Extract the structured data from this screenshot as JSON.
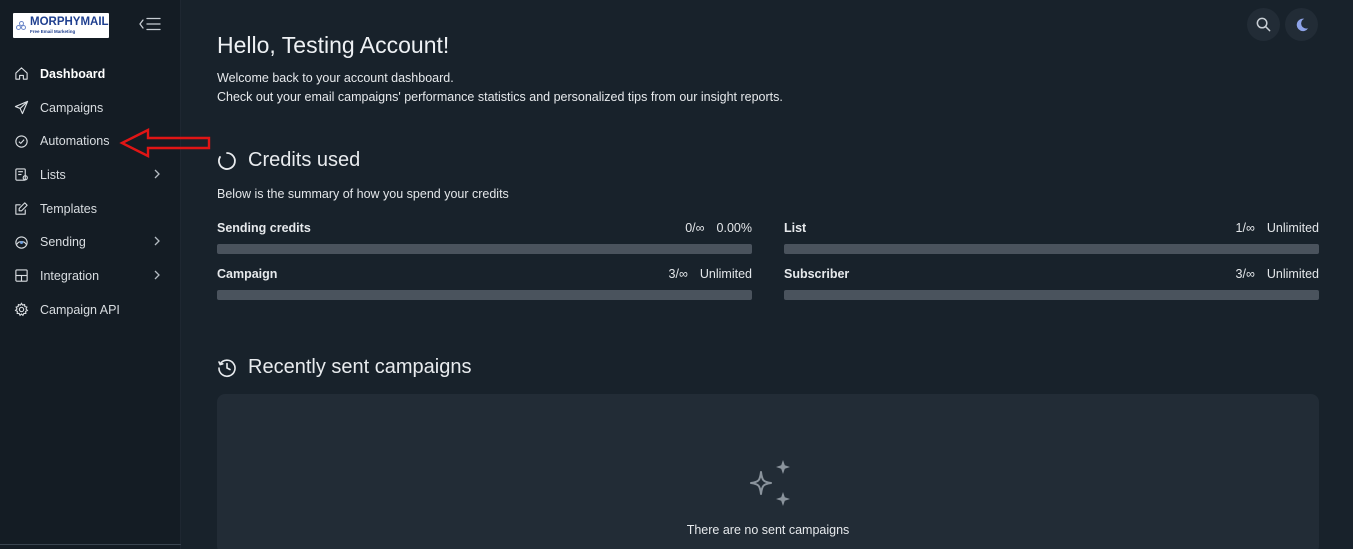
{
  "brand": {
    "logo_title": "MORPHYMAIL",
    "logo_subtitle": "Free Email Marketing"
  },
  "sidebar": {
    "items": [
      {
        "label": "Dashboard",
        "icon": "home-icon",
        "active": true,
        "has_submenu": false
      },
      {
        "label": "Campaigns",
        "icon": "paper-plane-icon",
        "active": false,
        "has_submenu": false
      },
      {
        "label": "Automations",
        "icon": "shield-check-icon",
        "active": false,
        "has_submenu": false
      },
      {
        "label": "Lists",
        "icon": "list-icon",
        "active": false,
        "has_submenu": true
      },
      {
        "label": "Templates",
        "icon": "edit-icon",
        "active": false,
        "has_submenu": false
      },
      {
        "label": "Sending",
        "icon": "sending-icon",
        "active": false,
        "has_submenu": true
      },
      {
        "label": "Integration",
        "icon": "integration-icon",
        "active": false,
        "has_submenu": true
      },
      {
        "label": "Campaign API",
        "icon": "gear-icon",
        "active": false,
        "has_submenu": false
      }
    ]
  },
  "header": {
    "greeting": "Hello, Testing Account!",
    "welcome_line1": "Welcome back to your account dashboard.",
    "welcome_line2": "Check out your email campaigns' performance statistics and personalized tips from our insight reports."
  },
  "credits": {
    "title": "Credits used",
    "description": "Below is the summary of how you spend your credits",
    "items": [
      {
        "name": "Sending credits",
        "count": "0/∞",
        "value": "0.00%",
        "usage": 0
      },
      {
        "name": "List",
        "count": "1/∞",
        "value": "Unlimited",
        "usage": 0
      },
      {
        "name": "Campaign",
        "count": "3/∞",
        "value": "Unlimited",
        "usage": 0
      },
      {
        "name": "Subscriber",
        "count": "3/∞",
        "value": "Unlimited",
        "usage": 0
      }
    ]
  },
  "recent": {
    "title": "Recently sent campaigns",
    "empty_text": "There are no sent campaigns"
  },
  "colors": {
    "background": "#18222b",
    "sidebar": "#141c24",
    "panel": "#222c36",
    "bar": "#4a535d",
    "annotation_arrow": "#e01515",
    "moon_accent": "#8ea3e8"
  }
}
